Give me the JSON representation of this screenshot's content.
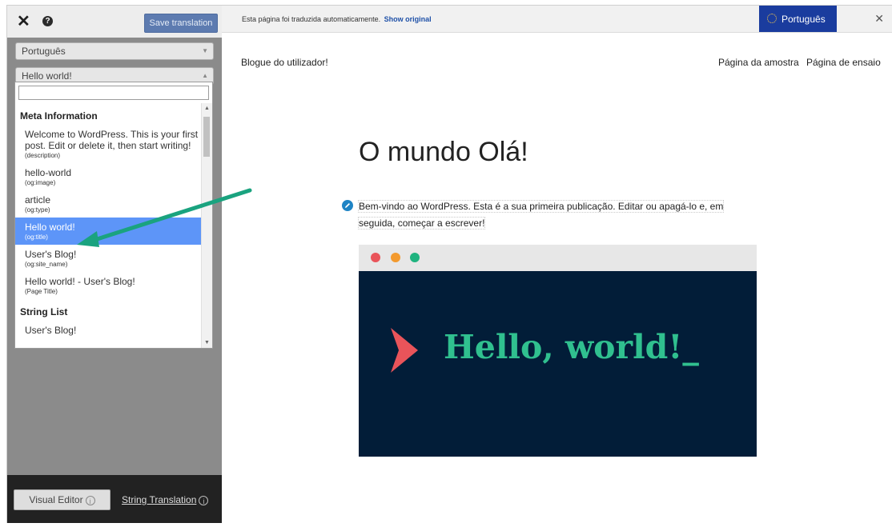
{
  "panel": {
    "save_label": "Save translation",
    "language_select": "Português",
    "string_select": "Hello world!",
    "search_placeholder": "",
    "groups": [
      {
        "title": "Meta Information",
        "items": [
          {
            "text": "Welcome to WordPress. This is your first post. Edit or delete it, then start writing!",
            "sub": "(description)"
          },
          {
            "text": "hello-world",
            "sub": "(og:image)"
          },
          {
            "text": "article",
            "sub": "(og:type)"
          },
          {
            "text": "Hello world!",
            "sub": "(og:title)",
            "selected": true
          },
          {
            "text": "User's Blog!",
            "sub": "(og:site_name)"
          },
          {
            "text": "Hello world! - User's Blog!",
            "sub": "(Page Title)"
          }
        ]
      },
      {
        "title": "String List",
        "items": [
          {
            "text": "User's Blog!",
            "sub": ""
          }
        ]
      }
    ],
    "visual_editor_label": "Visual Editor",
    "string_translation_label": "String Translation",
    "info_glyph": "i"
  },
  "translate_bar": {
    "message": "Esta página foi traduzida automaticamente.",
    "show_original": "Show original",
    "language": "Português"
  },
  "site": {
    "title": "Blogue do utilizador!",
    "nav": [
      "Página da amostra",
      "Página de ensaio"
    ],
    "post_title": "O mundo Olá!",
    "post_body_1": "Bem-vindo ao WordPress. Esta é a sua primeira publicação. Editar ou apagá-lo e, em",
    "post_body_2": "seguida, começar a escrever!",
    "image_text": "Hello, world!_",
    "colors": {
      "dot_red": "#e9545a",
      "dot_orange": "#f39a2e",
      "dot_green": "#1fb37f",
      "chevron": "#e9545a",
      "hello_text": "#30c08f",
      "image_bg": "#021d38",
      "arrow": "#1aa37f"
    }
  }
}
